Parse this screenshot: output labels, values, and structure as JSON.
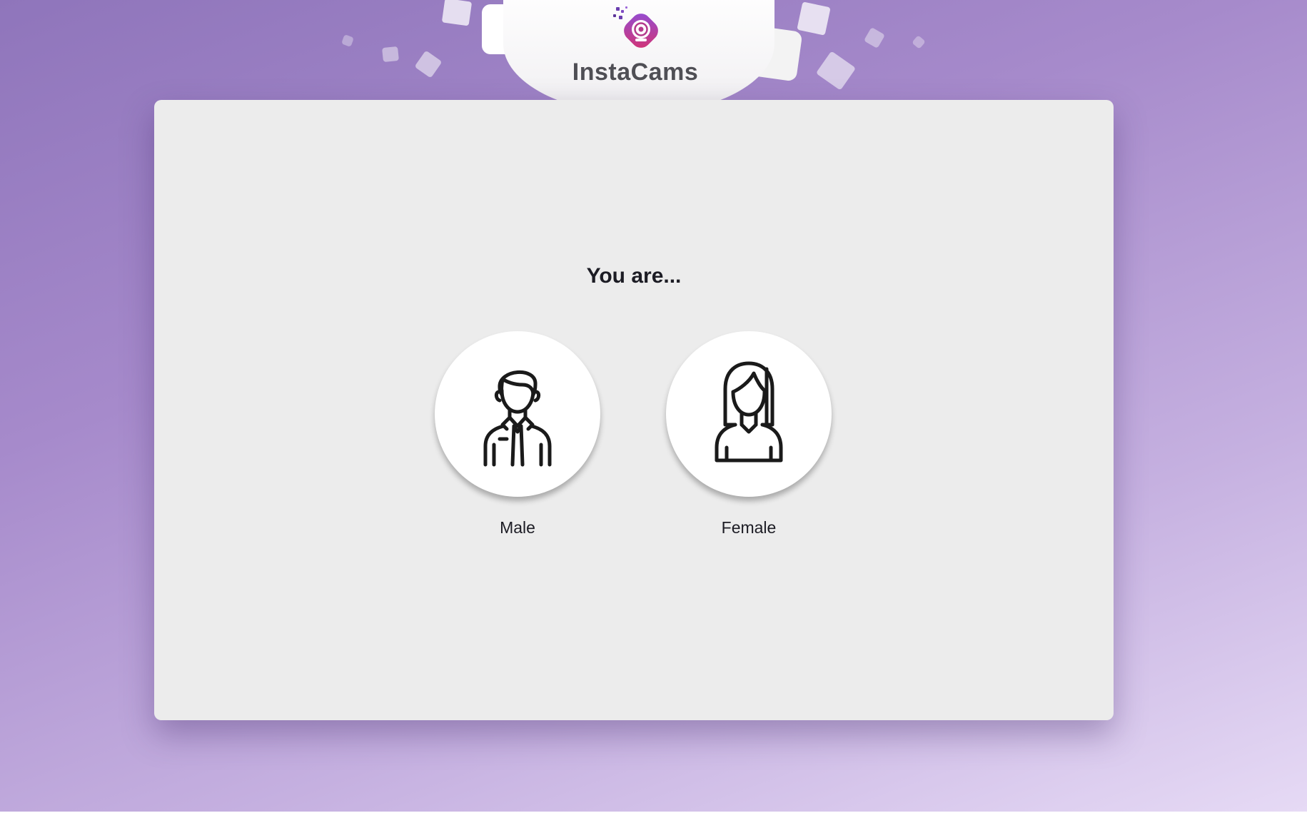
{
  "brand": {
    "name": "InstaCams",
    "logo_icon": "webcam-icon",
    "gradient_start": "#8f4fd8",
    "gradient_end": "#d6326f"
  },
  "question": "You are...",
  "options": [
    {
      "label": "Male",
      "icon": "male-avatar-icon"
    },
    {
      "label": "Female",
      "icon": "female-avatar-icon"
    }
  ],
  "colors": {
    "background_start": "#8f75bb",
    "background_end": "#e6daf5",
    "card": "#ececec",
    "text": "#1c1c24"
  }
}
